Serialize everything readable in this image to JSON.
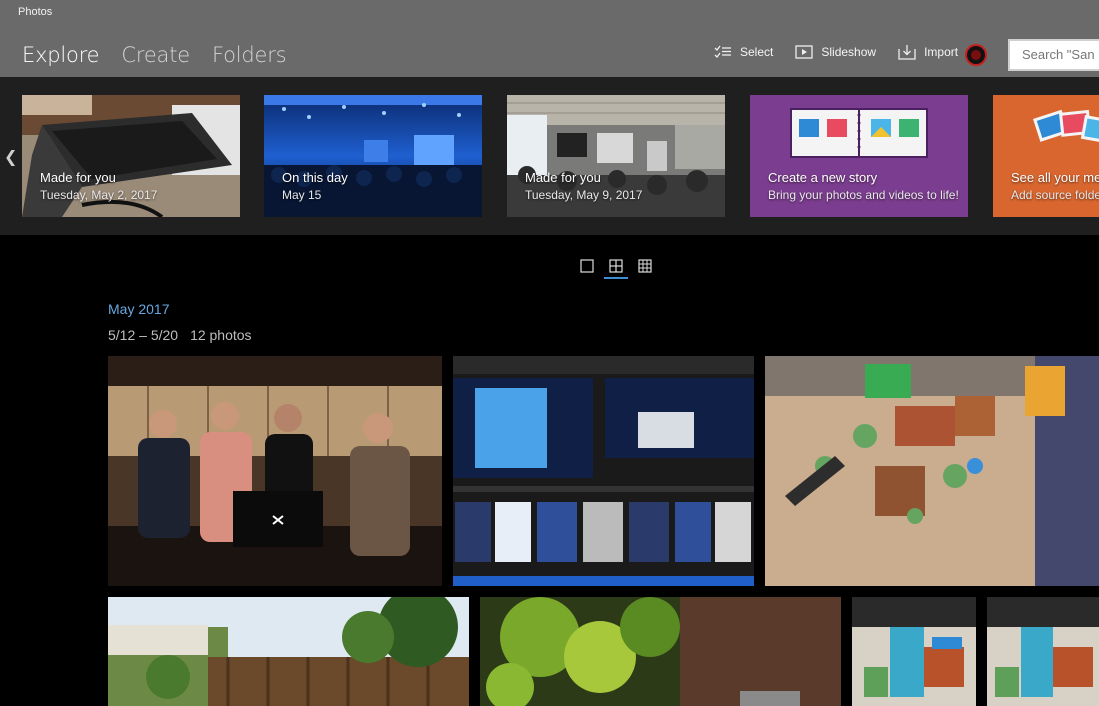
{
  "app": {
    "title": "Photos"
  },
  "nav": {
    "tabs": [
      "Explore",
      "Create",
      "Folders"
    ],
    "active": "Explore"
  },
  "toolbar": {
    "select_label": "Select",
    "slideshow_label": "Slideshow",
    "import_label": "Import"
  },
  "search": {
    "placeholder": "Search \"San"
  },
  "highlights": [
    {
      "title": "Made for you",
      "subtitle": "Tuesday, May 2, 2017"
    },
    {
      "title": "On this day",
      "subtitle": "May 15"
    },
    {
      "title": "Made for you",
      "subtitle": "Tuesday, May 9, 2017"
    },
    {
      "title": "Create a new story",
      "subtitle": "Bring your photos and videos to life!"
    },
    {
      "title": "See all your me",
      "subtitle": "Add source folde"
    }
  ],
  "views": [
    "single",
    "medium-grid",
    "small-grid"
  ],
  "active_view": "medium-grid",
  "section": {
    "month": "May 2017",
    "date_range": "5/12 – 5/20",
    "count": "12 photos"
  },
  "colors": {
    "accent": "#69a7e0",
    "header_bg": "#6a6a6a",
    "strip_bg": "#1f1f1f",
    "story_card": "#7a3d8c",
    "folders_card": "#d9662f"
  }
}
